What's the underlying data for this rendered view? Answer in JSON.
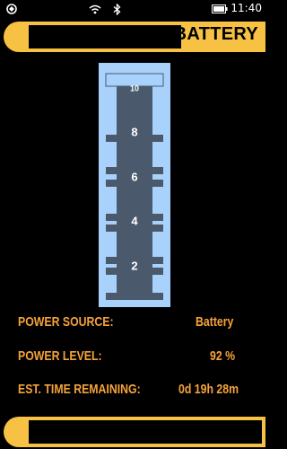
{
  "status_bar": {
    "time": "11:40",
    "icons": [
      "notification-icon",
      "wifi-icon",
      "bluetooth-icon",
      "battery-icon"
    ]
  },
  "header": {
    "title": "BATTERY"
  },
  "gauge": {
    "level_percent": 92,
    "scale_labels": [
      "10",
      "8",
      "6",
      "4",
      "2"
    ],
    "colors": {
      "background": "#a8d2fb",
      "segments": "#4a5a6c",
      "labels": "#ffffff"
    }
  },
  "info": {
    "power_source_label": "POWER SOURCE:",
    "power_source_value": "Battery",
    "power_level_label": "POWER LEVEL:",
    "power_level_value": "92 %",
    "time_remaining_label": "EST. TIME REMAINING:",
    "time_remaining_value": "0d  19h  28m"
  },
  "theme": {
    "frame": "#f7c144",
    "text": "#f7a33a"
  }
}
